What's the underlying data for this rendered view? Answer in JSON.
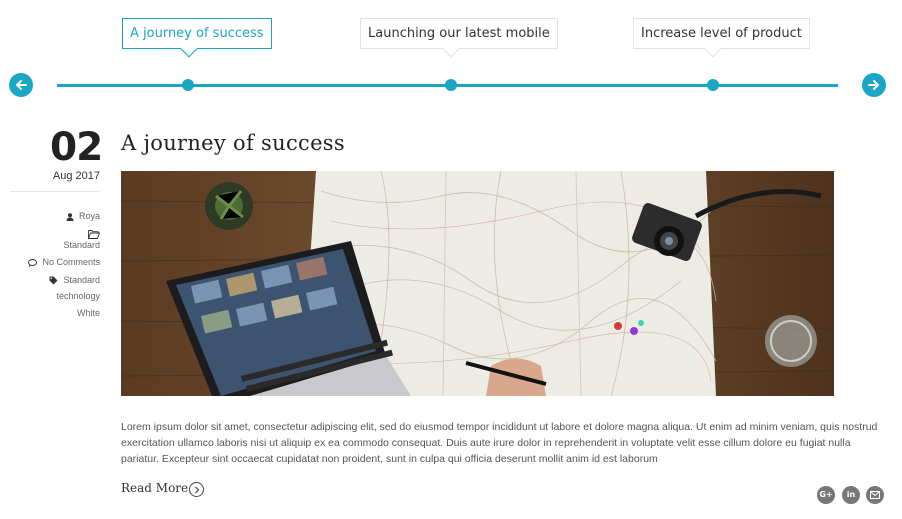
{
  "timeline": {
    "events": [
      {
        "label": "A journey of success",
        "active": true
      },
      {
        "label": "Launching our latest mobile",
        "active": false
      },
      {
        "label": "Increase level of product",
        "active": false
      }
    ],
    "prev_icon": "arrow-left-icon",
    "next_icon": "arrow-right-icon"
  },
  "post": {
    "day": "02",
    "month_year": "Aug 2017",
    "author": "Roya",
    "category": "Standard",
    "comments": "No Comments",
    "tags": [
      "Standard",
      "technology",
      "White"
    ],
    "title": "A journey of success",
    "image_alt": "Laptop, map and camera on wooden desk",
    "body": "Lorem ipsum dolor sit amet, consectetur adipiscing elit, sed do eiusmod tempor incididunt ut labore et dolore magna aliqua. Ut enim ad minim veniam, quis nostrud exercitation ullamco laboris nisi ut aliquip ex ea commodo consequat. Duis aute irure dolor in reprehenderit in voluptate velit esse cillum dolore eu fugiat nulla pariatur. Excepteur sint occaecat cupidatat non proident, sunt in culpa qui officia deserunt mollit anim id est laborum",
    "read_more": "Read More"
  },
  "share": {
    "google": "G+",
    "linkedin": "in",
    "email_icon": "envelope-icon"
  },
  "colors": {
    "accent": "#1ba7c4",
    "text_dark": "#222222",
    "share_bg": "#777777"
  }
}
